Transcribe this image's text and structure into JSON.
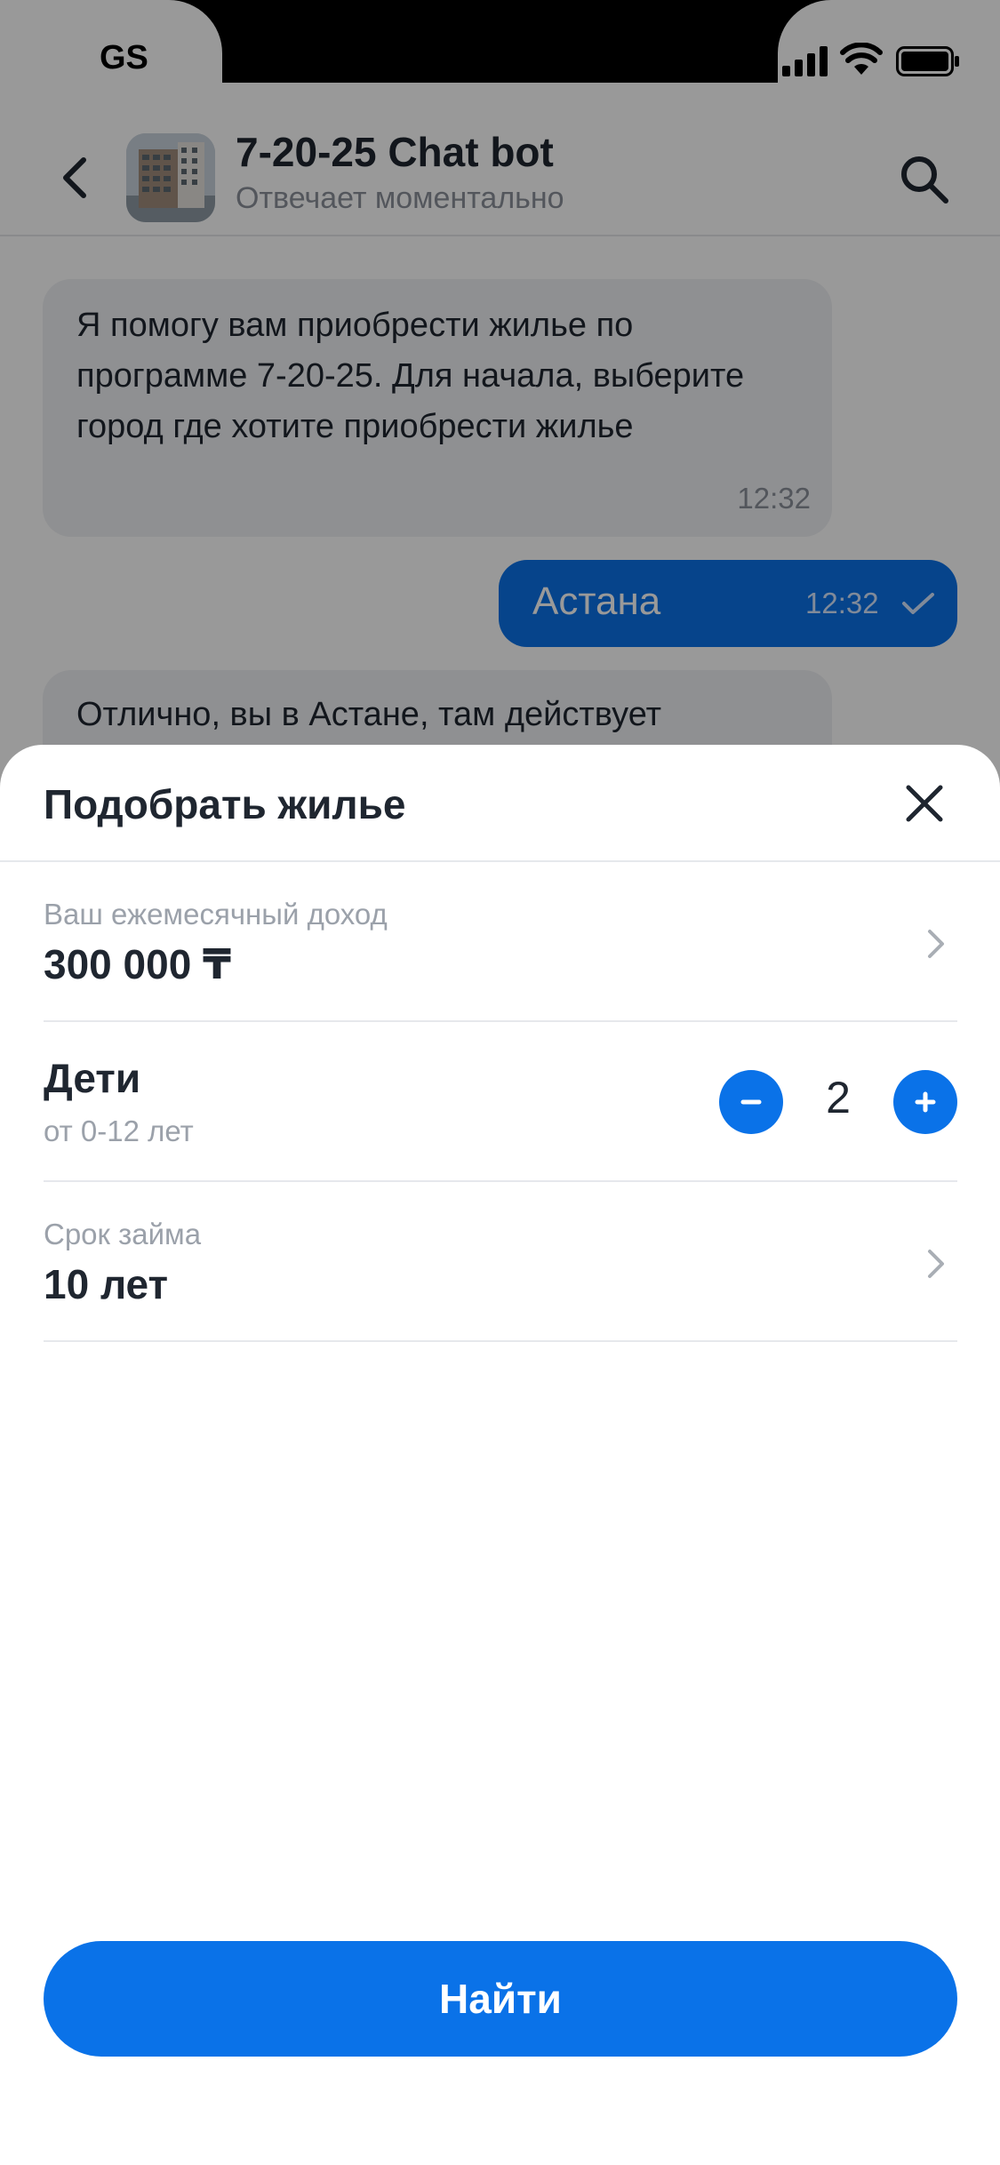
{
  "status_bar": {
    "carrier": "GS",
    "icons": [
      "signal-icon",
      "wifi-icon",
      "battery-icon"
    ]
  },
  "chat": {
    "title": "7-20-25 Chat bot",
    "subtitle": "Отвечает моментально",
    "messages": [
      {
        "direction": "incoming",
        "text": "Я помогу вам приобрести жилье по программе 7-20-25. Для начала, выберите город где хотите приобрести жилье",
        "time": "12:32"
      },
      {
        "direction": "outgoing",
        "text": "Астана",
        "time": "12:32",
        "status": "sent"
      },
      {
        "direction": "incoming",
        "text": "Отлично, вы в Астане, там действует"
      }
    ]
  },
  "sheet": {
    "title": "Подобрать жилье",
    "income": {
      "label": "Ваш ежемесячный доход",
      "value": "300 000 ₸"
    },
    "children": {
      "title": "Дети",
      "subtitle": "от 0-12 лет",
      "count": "2"
    },
    "term": {
      "label": "Срок займа",
      "value": "10 лет"
    },
    "submit_label": "Найти"
  },
  "colors": {
    "accent": "#0a72e8",
    "text_primary": "#1f2630",
    "text_secondary": "#9ba1aa",
    "overlay": "rgba(0,0,0,0.40)"
  }
}
